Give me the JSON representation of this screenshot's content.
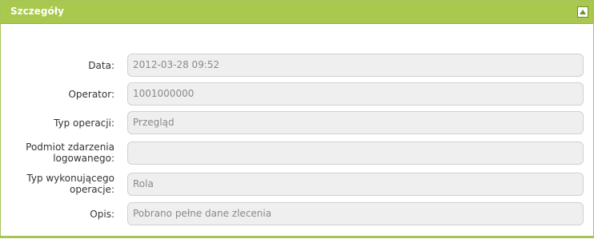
{
  "panel": {
    "title": "Szczegóły",
    "fields": [
      {
        "label": "Data:",
        "value": "2012-03-28 09:52"
      },
      {
        "label": "Operator:",
        "value": "1001000000"
      },
      {
        "label": "Typ operacji:",
        "value": "Przegląd"
      },
      {
        "label": "Podmiot zdarzenia logowanego:",
        "value": ""
      },
      {
        "label": "Typ wykonującego operacje:",
        "value": "Rola"
      },
      {
        "label": "Opis:",
        "value": "Pobrano pełne dane zlecenia"
      }
    ]
  },
  "colors": {
    "header": "#a8c84e",
    "field_bg": "#efefef"
  }
}
